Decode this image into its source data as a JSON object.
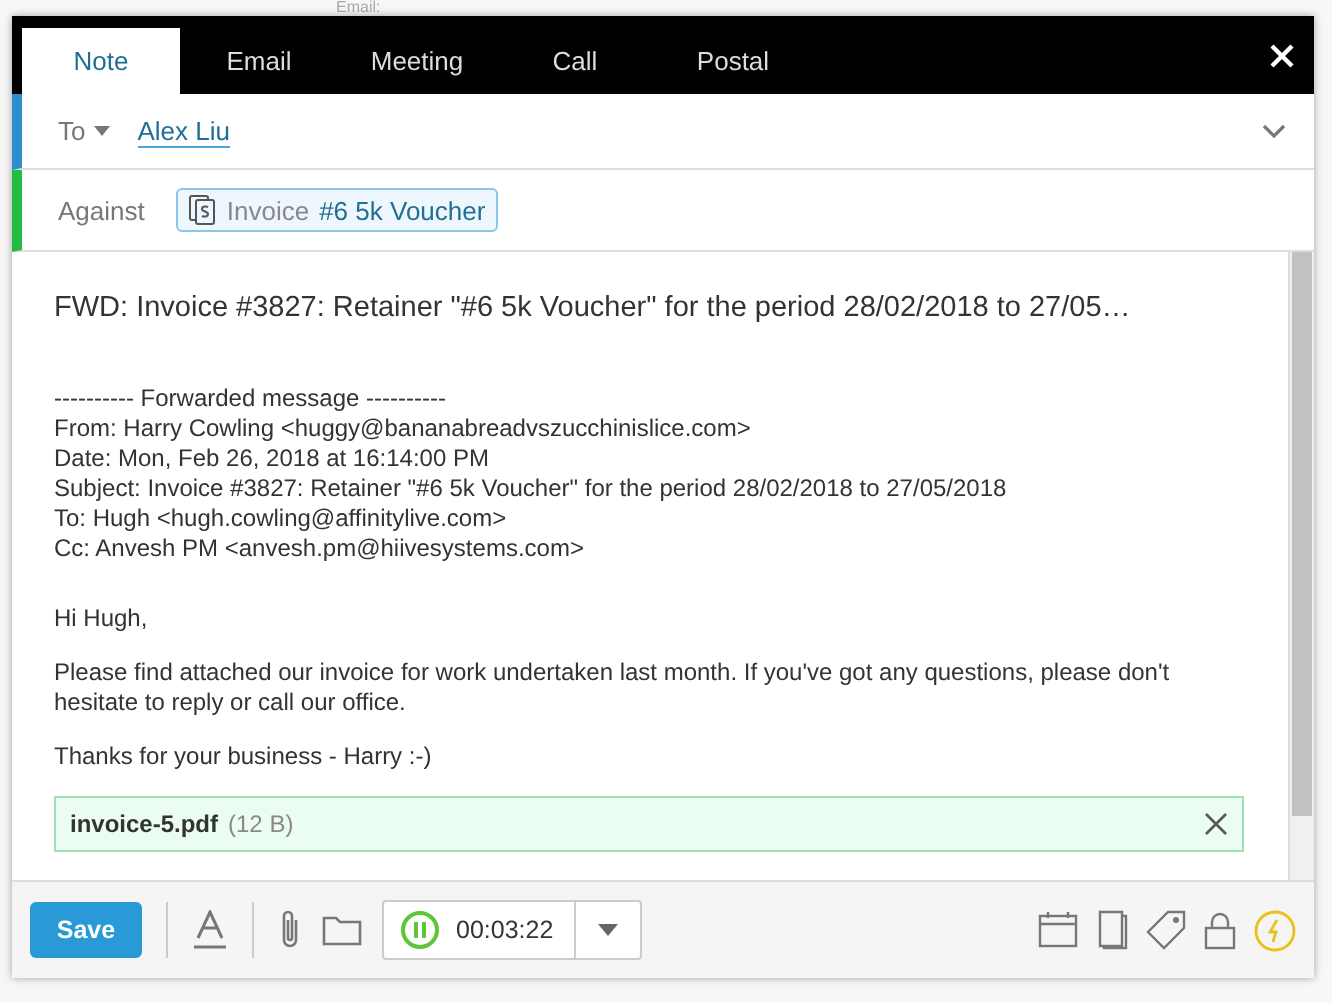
{
  "background": {
    "label": "Email:"
  },
  "tabs": [
    {
      "label": "Note",
      "selected": true
    },
    {
      "label": "Email",
      "selected": false
    },
    {
      "label": "Meeting",
      "selected": false
    },
    {
      "label": "Call",
      "selected": false
    },
    {
      "label": "Postal",
      "selected": false
    }
  ],
  "to": {
    "label": "To",
    "recipient": "Alex Liu"
  },
  "against": {
    "label": "Against",
    "chip_type": "Invoice",
    "chip_name": "#6 5k Voucher"
  },
  "subject": "FWD: Invoice #3827: Retainer \"#6 5k Voucher\" for the period 28/02/2018 to 27/05…",
  "forwarded": [
    "---------- Forwarded message ----------",
    "From: Harry Cowling <huggy@bananabreadvszucchinislice.com>",
    "Date: Mon, Feb 26, 2018 at 16:14:00 PM",
    "Subject: Invoice #3827: Retainer \"#6 5k Voucher\" for the period 28/02/2018 to 27/05/2018",
    "To: Hugh <hugh.cowling@affinitylive.com>",
    "Cc: Anvesh PM <anvesh.pm@hiivesystems.com>"
  ],
  "paragraphs": [
    "Hi Hugh,",
    "Please find attached our invoice for work undertaken last month. If you've got any questions, please don't hesitate to reply or call our office.",
    "Thanks for your business - Harry :-)"
  ],
  "attachment": {
    "name": "invoice-5.pdf",
    "size": "(12 B)"
  },
  "toolbar": {
    "save": "Save",
    "timer": {
      "time": "00:03:22",
      "running": true
    }
  }
}
